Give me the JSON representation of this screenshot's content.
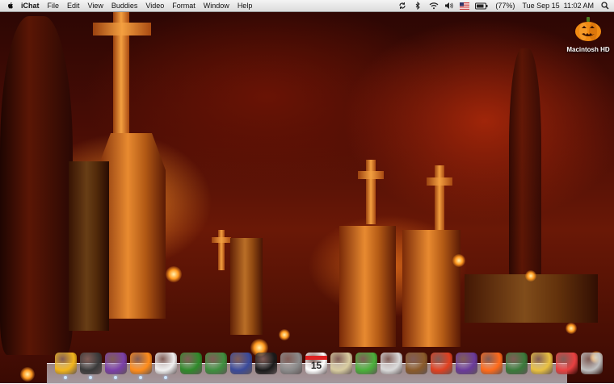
{
  "menubar": {
    "apple_icon": "apple-logo-icon",
    "app_name": "iChat",
    "menus": [
      "File",
      "Edit",
      "View",
      "Buddies",
      "Video",
      "Format",
      "Window",
      "Help"
    ],
    "status": {
      "sync_icon": "sync-icon",
      "bluetooth_icon": "bluetooth-icon",
      "wifi_icon": "wifi-icon",
      "volume_icon": "volume-icon",
      "flag_icon": "us-flag-icon",
      "battery_icon": "battery-icon",
      "battery_text": "(77%)",
      "clock": "Tue Sep 15  11:02 AM",
      "spotlight_icon": "spotlight-search-icon"
    }
  },
  "desktop": {
    "hd_icon": "pumpkin-drive-icon",
    "hd_label": "Macintosh HD"
  },
  "dock": {
    "items": [
      {
        "name": "finder-icon",
        "color": "#f2b51c"
      },
      {
        "name": "dashboard-icon",
        "color": "#3a3a3a"
      },
      {
        "name": "pumpkin-ghost-icon",
        "color": "#7a3fa8"
      },
      {
        "name": "pumpkin-icon",
        "color": "#ff8c1a"
      },
      {
        "name": "scream-mask-icon",
        "color": "#f0f0f0"
      },
      {
        "name": "cauldron-icon",
        "color": "#2f8a2a"
      },
      {
        "name": "spellbook-icon",
        "color": "#3e8f3e"
      },
      {
        "name": "haunted-house-icon",
        "color": "#3a4a9a"
      },
      {
        "name": "black-cat-icon",
        "color": "#1a1a1a"
      },
      {
        "name": "tombstone-icon",
        "color": "#8a8a8a"
      },
      {
        "name": "calendar-icon",
        "color": "#ffffff",
        "text": "15"
      },
      {
        "name": "mummy-icon",
        "color": "#d8cca0"
      },
      {
        "name": "frankenstein-icon",
        "color": "#4ab03a"
      },
      {
        "name": "skull-plate-icon",
        "color": "#d9d9d9"
      },
      {
        "name": "witch-hat-icon",
        "color": "#8a5a2a"
      },
      {
        "name": "candle-icon",
        "color": "#e04020"
      },
      {
        "name": "bat-icon",
        "color": "#6a3a9a"
      },
      {
        "name": "candy-corn-icon",
        "color": "#ff6a1a"
      },
      {
        "name": "photo-frame-icon",
        "color": "#3a7a3a"
      },
      {
        "name": "treasure-chest-icon",
        "color": "#e8c040"
      },
      {
        "name": "potion-icon",
        "color": "#e84040"
      },
      {
        "name": "trash-icon",
        "color": "#c0c0c0"
      }
    ]
  }
}
